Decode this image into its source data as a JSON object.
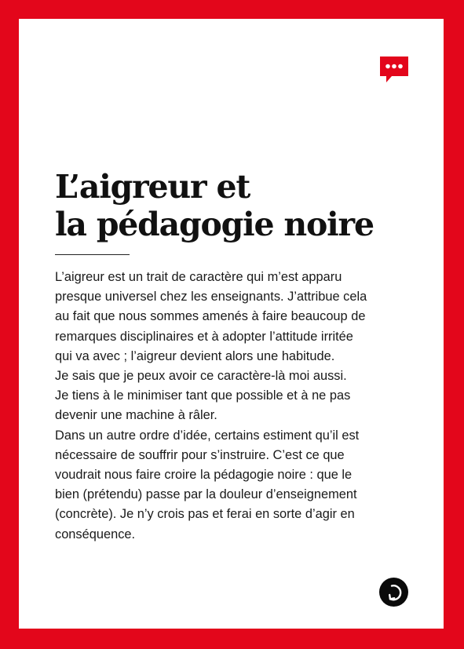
{
  "colors": {
    "frame": "#e3061b",
    "accent": "#e3061b",
    "text": "#1a1a1a",
    "button": "#0a0a0a"
  },
  "icons": {
    "top": "speech-bubble-ellipsis-icon",
    "bottom": "circular-arrow-icon"
  },
  "title": {
    "line1": "L’aigreur et",
    "line2": "la pédagogie noire"
  },
  "body": {
    "lines": [
      "L’aigreur est un trait de caractère qui m’est apparu",
      "presque universel chez les enseignants. J’attribue cela",
      "au fait que nous sommes amenés à faire beaucoup de",
      "remarques disciplinaires et à adopter l’attitude irritée",
      "qui va avec ; l’aigreur devient alors une habitude.",
      "Je sais que je peux avoir ce caractère-là moi aussi.",
      "Je tiens à le minimiser tant que possible et à ne pas",
      "devenir une machine à râler.",
      "Dans un autre ordre d’idée, certains estiment qu’il est",
      "nécessaire de souffrir pour s’instruire. C’est ce que",
      "voudrait nous faire croire la pédagogie noire : que le",
      "bien (prétendu) passe par la douleur d’enseignement",
      "(concrète). Je n’y crois pas et ferai en sorte d’agir en",
      "conséquence."
    ]
  }
}
